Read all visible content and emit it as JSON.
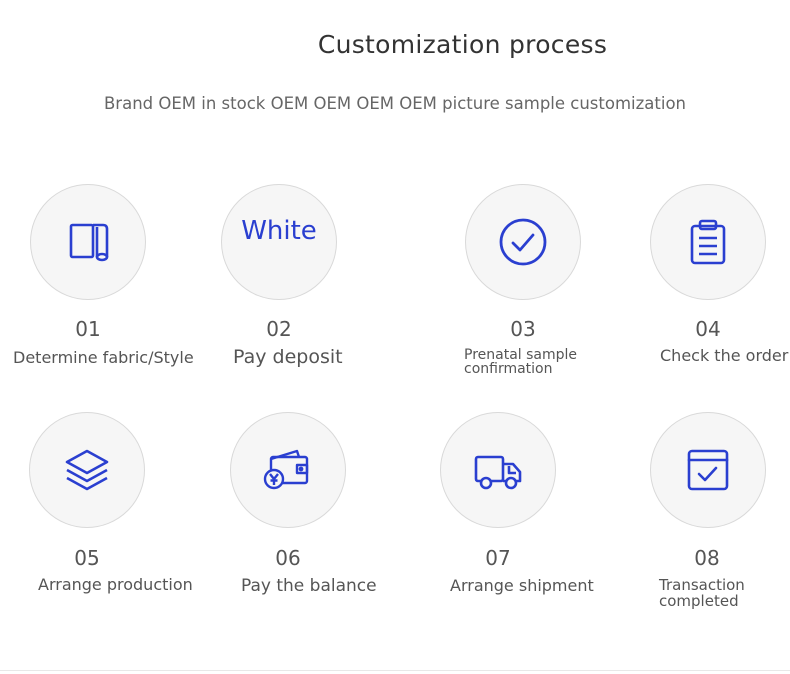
{
  "header": {
    "title": "Customization process",
    "subtitle": "Brand OEM in stock OEM OEM OEM OEM picture sample customization"
  },
  "colors": {
    "accent": "#2a3fd0",
    "circle_bg": "#f6f6f6",
    "circle_border": "#d9d9d9"
  },
  "steps": [
    {
      "number": "01",
      "label": "Determine fabric/Style",
      "icon": "fabric-roll-icon"
    },
    {
      "number": "02",
      "label": "Pay deposit",
      "icon_text": "White"
    },
    {
      "number": "03",
      "label_line1": "Prenatal sample",
      "label_line2": "confirmation",
      "icon": "check-circle-icon"
    },
    {
      "number": "04",
      "label": "Check the order",
      "icon": "clipboard-icon"
    },
    {
      "number": "05",
      "label": "Arrange production",
      "icon": "layers-icon"
    },
    {
      "number": "06",
      "label": "Pay the balance",
      "icon": "wallet-yen-icon"
    },
    {
      "number": "07",
      "label": "Arrange shipment",
      "icon": "truck-icon"
    },
    {
      "number": "08",
      "label_line1": "Transaction",
      "label_line2": "completed",
      "icon": "calendar-check-icon"
    }
  ]
}
